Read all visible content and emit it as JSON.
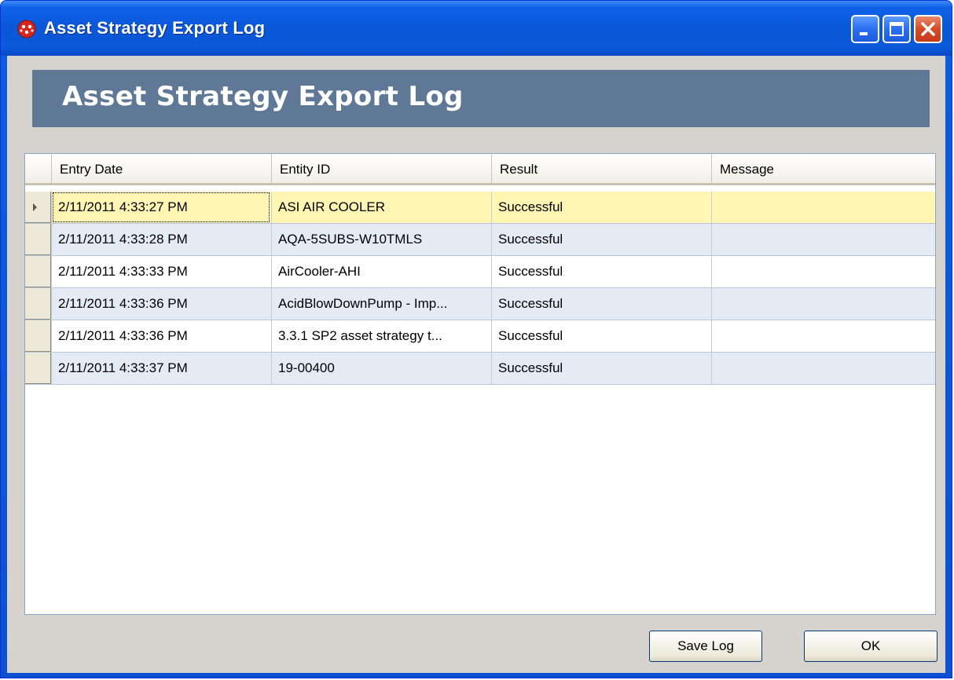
{
  "window": {
    "title": "Asset Strategy Export Log",
    "app_icon": "red-molecule-icon",
    "controls": [
      "minimize-icon",
      "maximize-icon",
      "close-icon"
    ]
  },
  "banner": {
    "title": "Asset Strategy Export Log"
  },
  "grid": {
    "columns": [
      "Entry Date",
      "Entity ID",
      "Result",
      "Message"
    ],
    "rows": [
      {
        "entry_date": "2/11/2011 4:33:27 PM",
        "entity_id": "ASI AIR COOLER",
        "result": "Successful",
        "message": ""
      },
      {
        "entry_date": "2/11/2011 4:33:28 PM",
        "entity_id": "AQA-5SUBS-W10TMLS",
        "result": "Successful",
        "message": ""
      },
      {
        "entry_date": "2/11/2011 4:33:33 PM",
        "entity_id": "AirCooler-AHI",
        "result": "Successful",
        "message": ""
      },
      {
        "entry_date": "2/11/2011 4:33:36 PM",
        "entity_id": "AcidBlowDownPump - Imp...",
        "result": "Successful",
        "message": ""
      },
      {
        "entry_date": "2/11/2011 4:33:36 PM",
        "entity_id": "3.3.1 SP2 asset strategy t...",
        "result": "Successful",
        "message": ""
      },
      {
        "entry_date": "2/11/2011 4:33:37 PM",
        "entity_id": "19-00400",
        "result": "Successful",
        "message": ""
      }
    ]
  },
  "buttons": {
    "save_log": "Save Log",
    "ok": "OK"
  },
  "colors": {
    "titlebar": "#0a57d8",
    "banner": "#5e7896",
    "selected_row": "#fff6b4",
    "alt_row": "#e5ebf5",
    "client_bg": "#d6d3ce"
  }
}
